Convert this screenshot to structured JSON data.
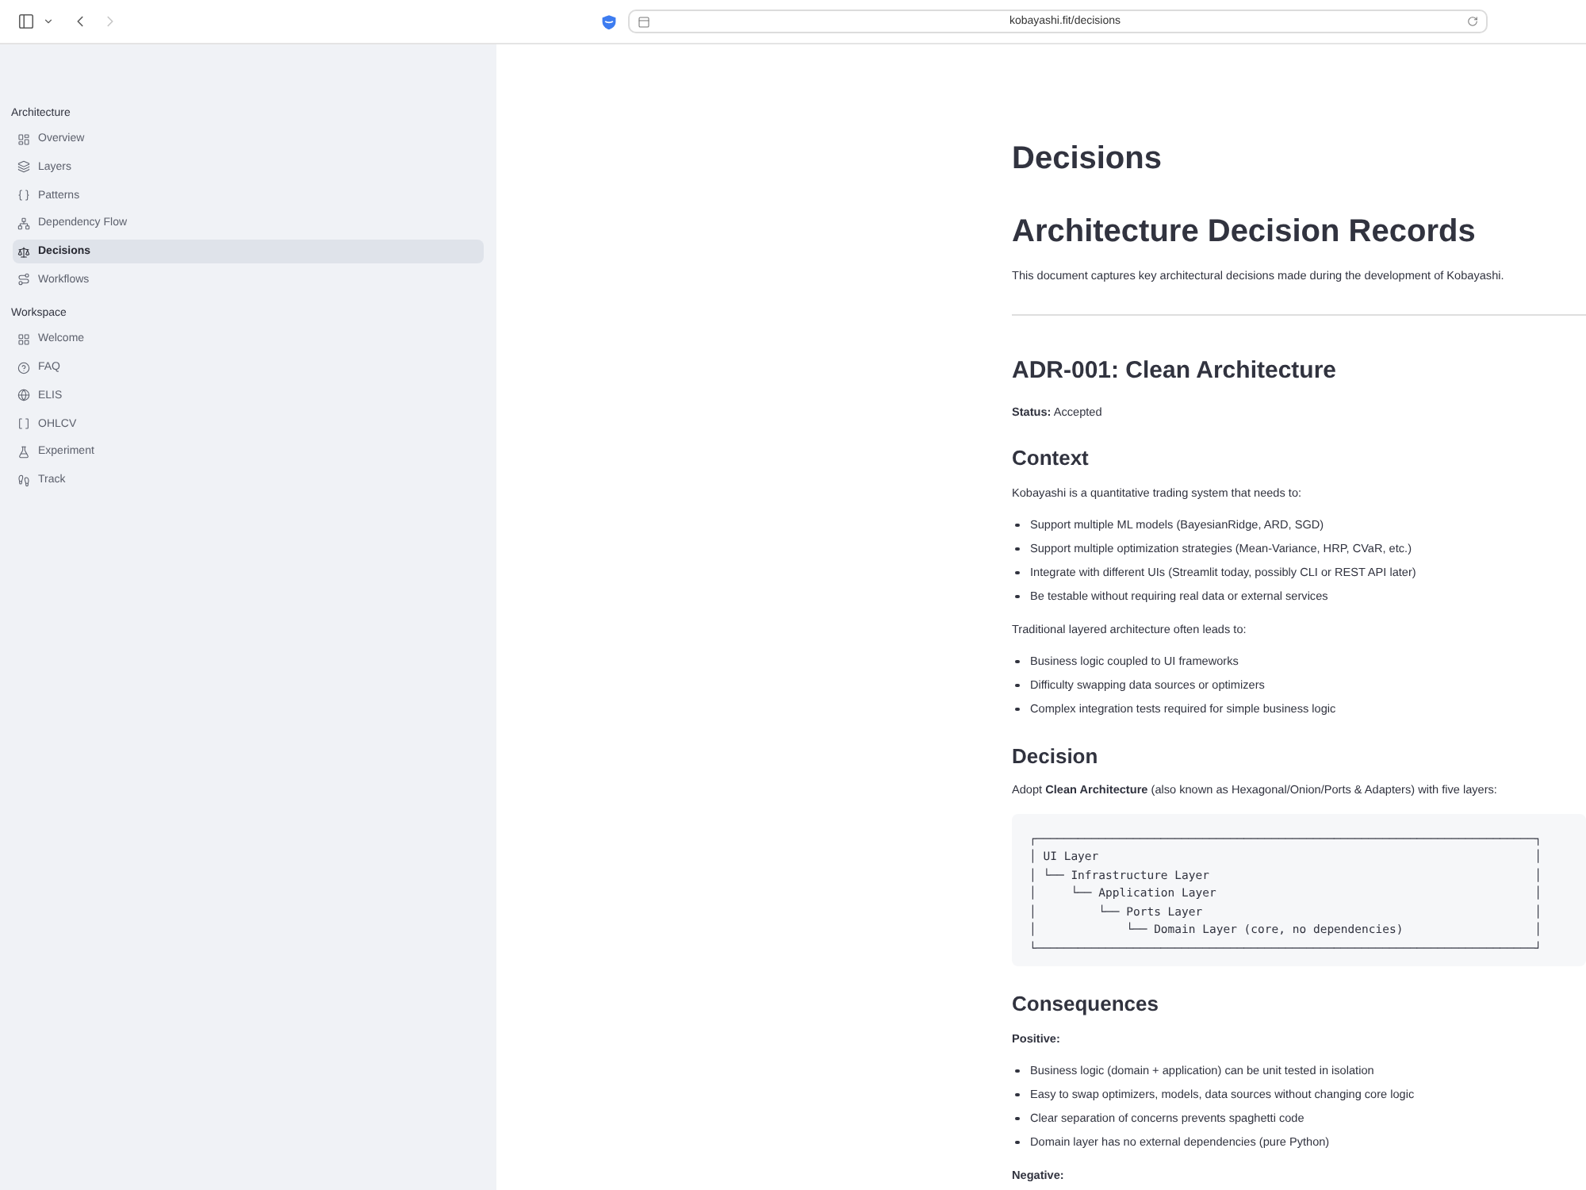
{
  "browser": {
    "navigation": {
      "back": {
        "disabled": false
      },
      "forward": {
        "disabled": true
      }
    },
    "url": "kobayashi.fit/decisions"
  },
  "sidebar": {
    "sections": [
      {
        "title": "Architecture",
        "items": [
          {
            "label": "Overview",
            "selected": false
          },
          {
            "label": "Layers",
            "selected": false
          },
          {
            "label": "Patterns",
            "selected": false
          },
          {
            "label": "Dependency Flow",
            "selected": false
          },
          {
            "label": "Decisions",
            "selected": true
          },
          {
            "label": "Workflows",
            "selected": false
          }
        ]
      },
      {
        "title": "Workspace",
        "items": [
          {
            "label": "Welcome",
            "selected": false
          },
          {
            "label": "FAQ",
            "selected": false
          },
          {
            "label": "ELIS",
            "selected": false
          },
          {
            "label": "OHLCV",
            "selected": false
          },
          {
            "label": "Experiment",
            "selected": false
          },
          {
            "label": "Track",
            "selected": false
          }
        ]
      }
    ]
  },
  "page": {
    "blocks": [
      {
        "kind": "title",
        "text": "Decisions"
      },
      {
        "kind": "heading1",
        "text": "Architecture Decision Records"
      },
      {
        "kind": "paragraph",
        "text": "This document captures key architectural decisions made during the development of Kobayashi."
      },
      {
        "kind": "rule"
      },
      {
        "kind": "heading2",
        "text": "ADR-001: Clean Architecture"
      },
      {
        "kind": "paragraph",
        "text": "**Status:** Accepted"
      },
      {
        "kind": "heading3",
        "text": "Context"
      },
      {
        "kind": "paragraph",
        "text": "Kobayashi is a quantitative trading system that needs to:"
      },
      {
        "kind": "list",
        "items": [
          "Support multiple ML models (BayesianRidge, ARD, SGD)",
          "Support multiple optimization strategies (Mean-Variance, HRP, CVaR, etc.)",
          "Integrate with different UIs (Streamlit today, possibly CLI or REST API later)",
          "Be testable without requiring real data or external services"
        ]
      },
      {
        "kind": "paragraph",
        "text": "Traditional layered architecture often leads to:"
      },
      {
        "kind": "list",
        "items": [
          "Business logic coupled to UI frameworks",
          "Difficulty swapping data sources or optimizers",
          "Complex integration tests required for simple business logic"
        ]
      },
      {
        "kind": "heading3",
        "text": "Decision"
      },
      {
        "kind": "paragraph",
        "text": "Adopt **Clean Architecture** (also known as Hexagonal/Onion/Ports & Adapters) with five layers:"
      },
      {
        "kind": "code",
        "lines": [
          "┌────────────────────────────────────────────────────────────────────────┐",
          "│ UI Layer                                                               │",
          "│ └── Infrastructure Layer                                               │",
          "│     └── Application Layer                                              │",
          "│         └── Ports Layer                                                │",
          "│             └── Domain Layer (core, no dependencies)                   │",
          "└────────────────────────────────────────────────────────────────────────┘"
        ]
      },
      {
        "kind": "heading3",
        "text": "Consequences"
      },
      {
        "kind": "label",
        "text": "Positive:"
      },
      {
        "kind": "list",
        "items": [
          "Business logic (domain + application) can be unit tested in isolation",
          "Easy to swap optimizers, models, data sources without changing core logic",
          "Clear separation of concerns prevents spaghetti code",
          "Domain layer has no external dependencies (pure Python)"
        ]
      },
      {
        "kind": "label",
        "text": "Negative:"
      }
    ]
  }
}
